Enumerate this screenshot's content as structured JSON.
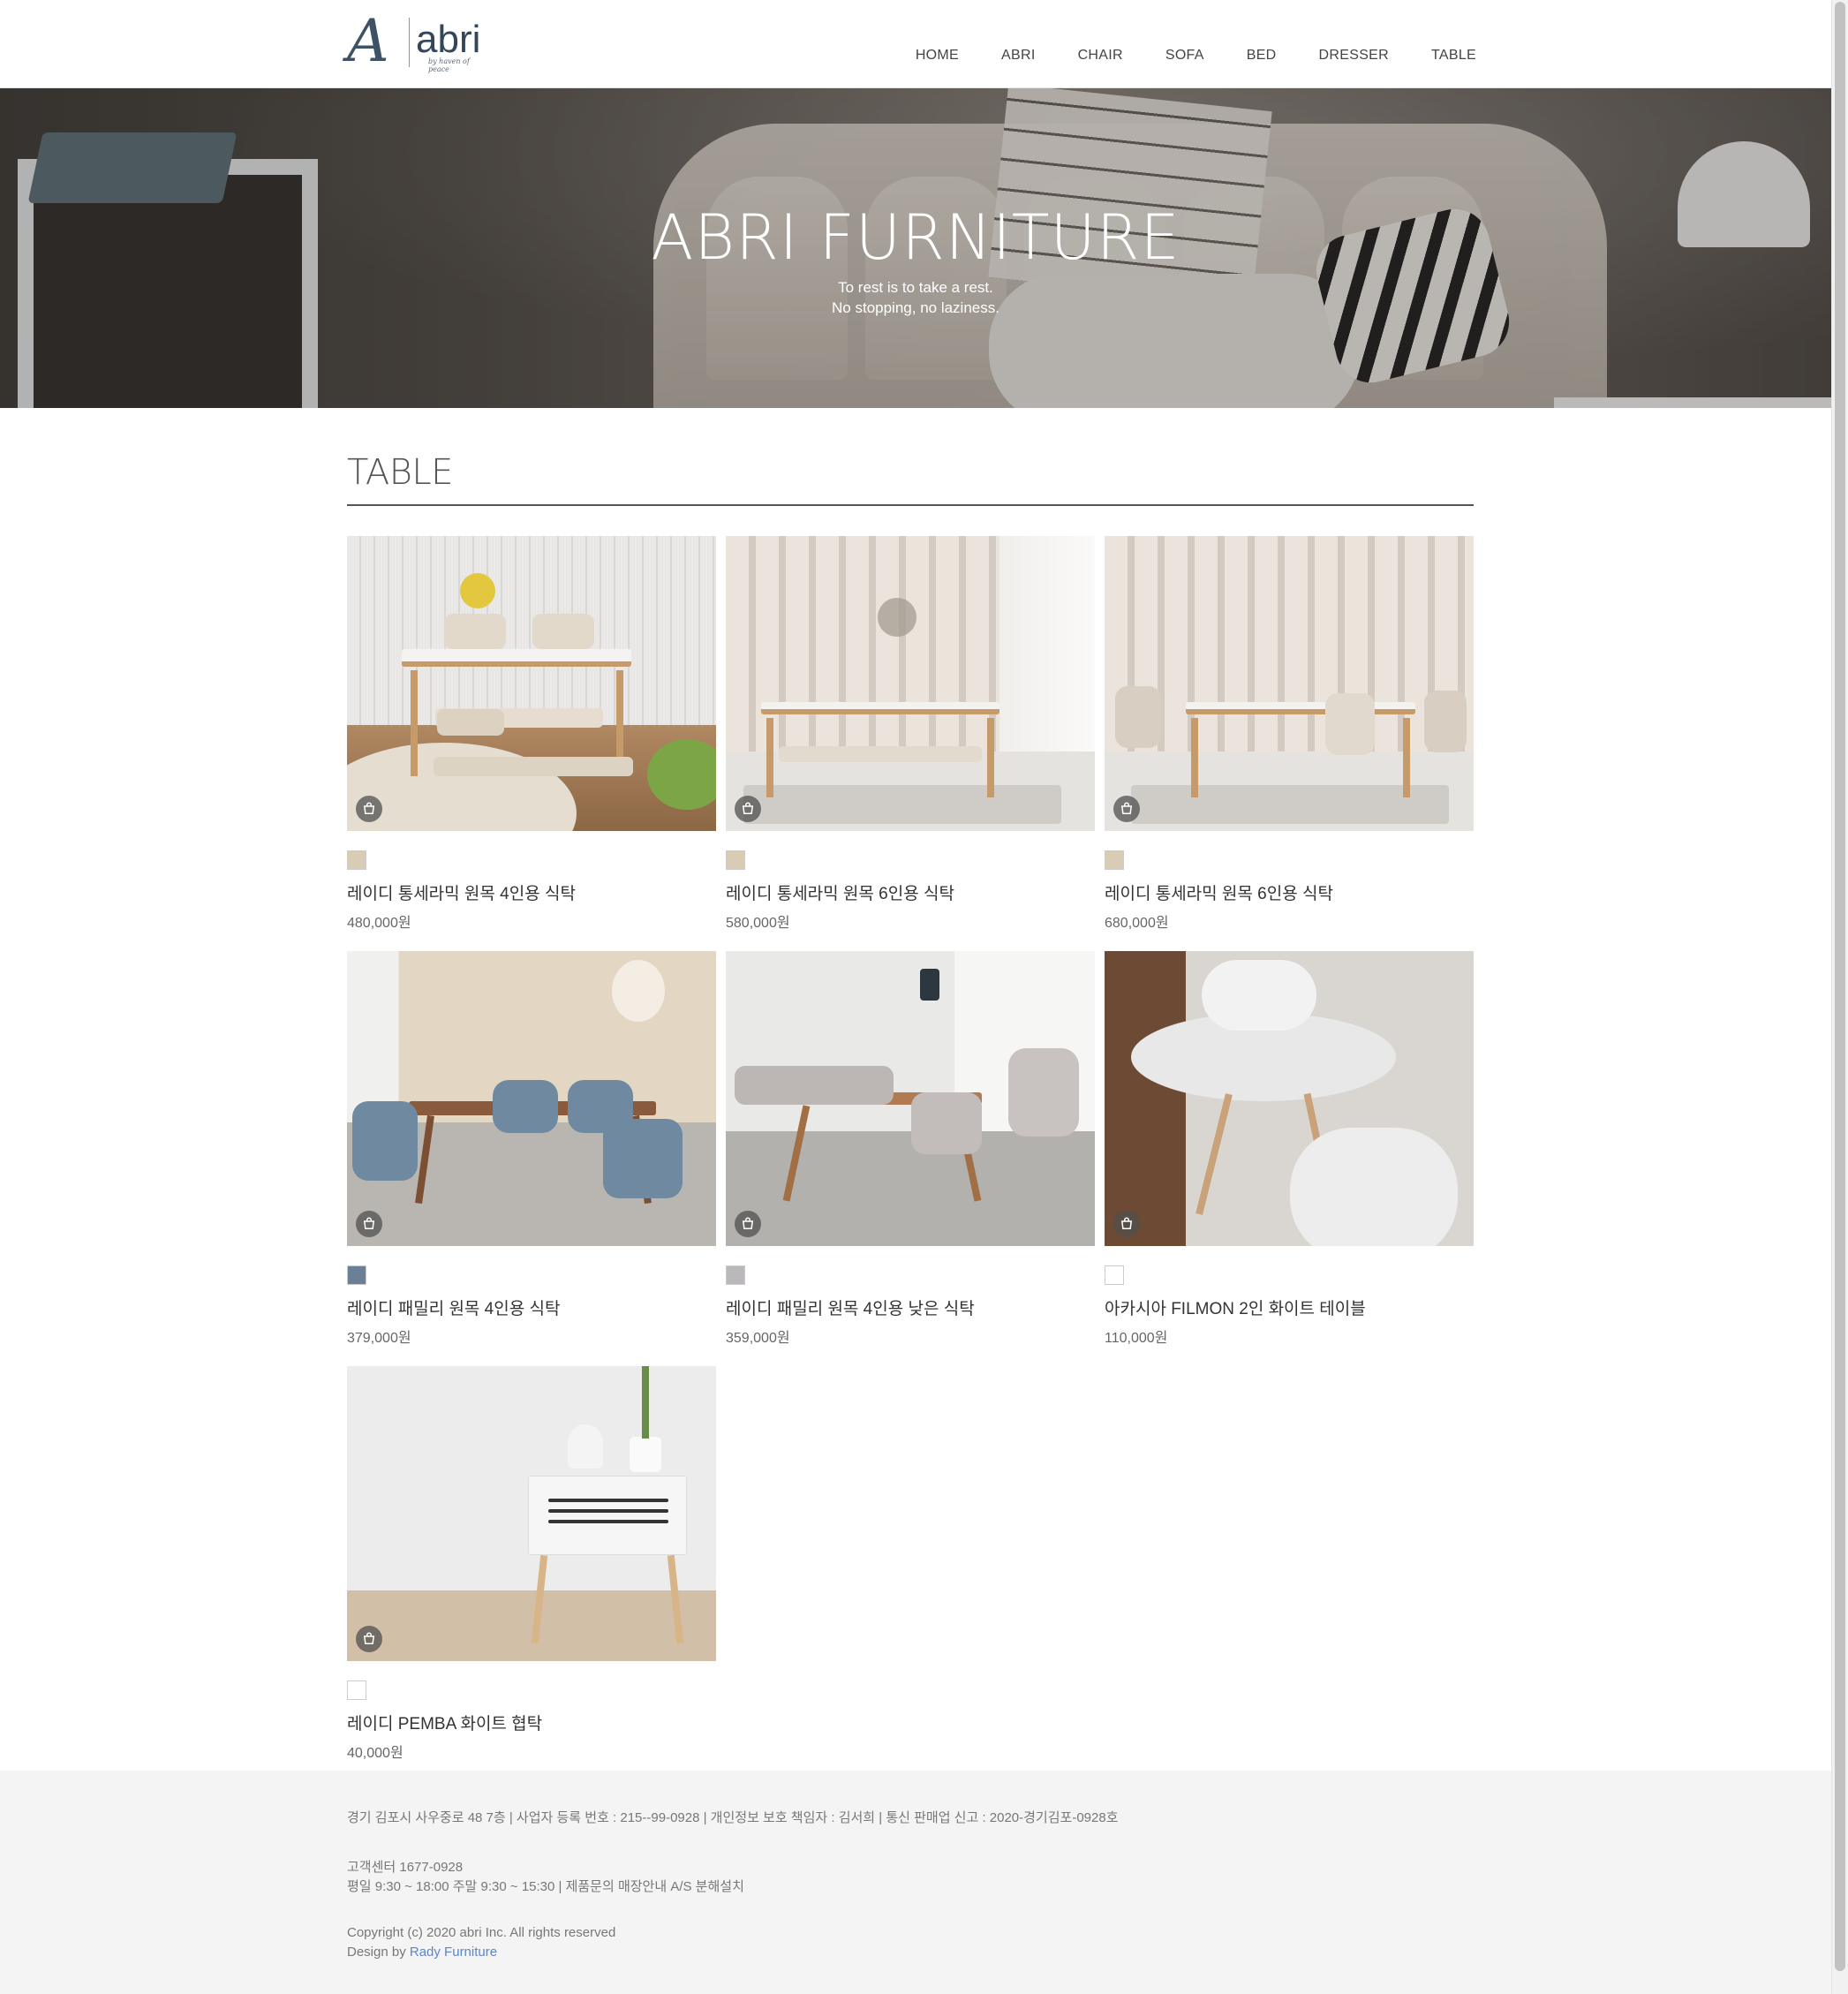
{
  "brand": {
    "logo_letter": "A",
    "logo_word": "abri",
    "logo_tagline": "by haven of peace"
  },
  "nav": {
    "items": [
      {
        "label": "HOME"
      },
      {
        "label": "ABRI"
      },
      {
        "label": "CHAIR"
      },
      {
        "label": "SOFA"
      },
      {
        "label": "BED"
      },
      {
        "label": "DRESSER"
      },
      {
        "label": "TABLE"
      }
    ]
  },
  "hero": {
    "title": "ABRI FURNITURE",
    "line1": "To rest is to take a rest.",
    "line2": "No stopping, no laziness."
  },
  "section": {
    "title": "TABLE"
  },
  "products": [
    {
      "name": "레이디 통세라믹 원목 4인용 식탁",
      "price": "480,000원",
      "swatch": "#d9ccb4",
      "icon": "cart-icon"
    },
    {
      "name": "레이디 통세라믹 원목 6인용 식탁",
      "price": "580,000원",
      "swatch": "#d9ccb4",
      "icon": "cart-icon"
    },
    {
      "name": "레이디 통세라믹 원목 6인용 식탁",
      "price": "680,000원",
      "swatch": "#d9ccb4",
      "icon": "cart-icon"
    },
    {
      "name": "레이디 패밀리 원목 4인용 식탁",
      "price": "379,000원",
      "swatch": "#6b8095",
      "icon": "cart-icon"
    },
    {
      "name": "레이디 패밀리 원목 4인용 낮은 식탁",
      "price": "359,000원",
      "swatch": "#bbb8bb",
      "icon": "cart-icon"
    },
    {
      "name": "아카시아 FILMON 2인 화이트 테이블",
      "price": "110,000원",
      "swatch": "#ffffff",
      "icon": "cart-icon"
    },
    {
      "name": "레이디 PEMBA 화이트 협탁",
      "price": "40,000원",
      "swatch": "#ffffff",
      "icon": "cart-icon"
    }
  ],
  "footer": {
    "address": "경기 김포시 사우중로 48 7층 | 사업자 등록 번호 : 215--99-0928 | 개인정보 보호 책임자 : 김서희 | 통신 판매업 신고 : 2020-경기김포-0928호",
    "cs_phone": "고객센터 1677-0928",
    "cs_hours": "평일 9:30 ~ 18:00 주말 9:30 ~ 15:30 | 제품문의 매장안내 A/S 분해설치",
    "copyright": "Copyright (c) 2020 abri Inc. All rights reserved",
    "design_by": "Design by",
    "design_link": "Rady Furniture"
  }
}
